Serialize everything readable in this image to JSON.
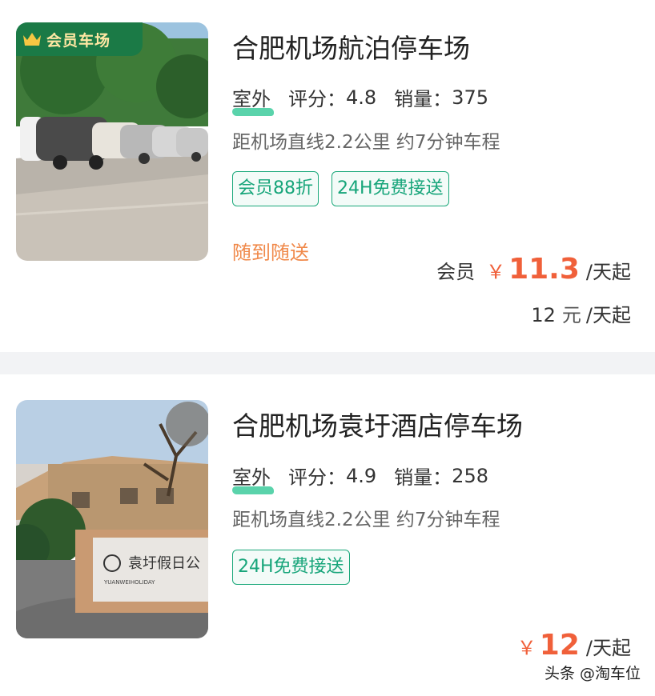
{
  "listings": [
    {
      "badge": "会员车场",
      "title": "合肥机场航泊停车场",
      "outdoor": "室外",
      "rating_label": "评分：",
      "rating": "4.8",
      "sales_label": "销量：",
      "sales": "375",
      "distance": "距机场直线2.2公里 约7分钟车程",
      "tags": [
        "会员88折",
        "24H免费接送"
      ],
      "service_note": "随到随送",
      "member_price_label": "会员",
      "currency": "￥",
      "member_price": "11.3",
      "per_day": "/天起",
      "normal_price": "12",
      "normal_unit": "元"
    },
    {
      "title": "合肥机场袁圩酒店停车场",
      "outdoor": "室外",
      "rating_label": "评分：",
      "rating": "4.9",
      "sales_label": "销量：",
      "sales": "258",
      "distance": "距机场直线2.2公里 约7分钟车程",
      "tags": [
        "24H免费接送"
      ],
      "currency": "￥",
      "price": "12",
      "per_day": "/天起",
      "sign_text": "袁圩假日公",
      "sign_subtext": "YUANWEIHOLIDAY"
    }
  ],
  "watermark": "头条 @淘车位",
  "colors": {
    "accent_green": "#1aa87a",
    "price_orange": "#f0603a",
    "note_orange": "#f0894a",
    "badge_green": "#1b7a46",
    "badge_text": "#ffe7a3"
  },
  "icons": [
    "crown-icon"
  ]
}
